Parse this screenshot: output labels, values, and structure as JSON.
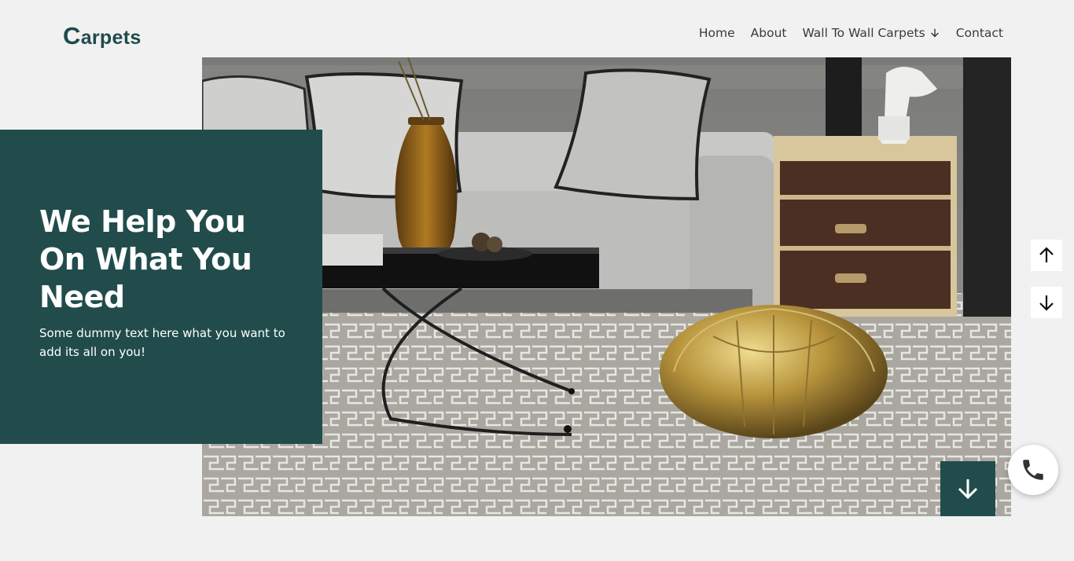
{
  "brand": {
    "logo_initial": "C",
    "logo_rest": "arpets",
    "color": "#1f4b4b"
  },
  "nav": {
    "items": [
      {
        "label": "Home"
      },
      {
        "label": "About"
      },
      {
        "label": "Wall To Wall Carpets",
        "icon": "arrow-down-icon"
      },
      {
        "label": "Contact"
      }
    ]
  },
  "hero": {
    "title": "We Help You On What You Need",
    "subtitle": "Some dummy text here what you want to add its all on you!",
    "panel_color": "#224c4c",
    "image_alt": "Living room with grey sofa, gold pouf, glass table and patterned carpet"
  },
  "controls": {
    "scroll_up_icon": "arrow-up-icon",
    "scroll_down_icon": "arrow-down-icon",
    "hero_down_icon": "arrow-down-icon",
    "phone_icon": "phone-icon"
  }
}
